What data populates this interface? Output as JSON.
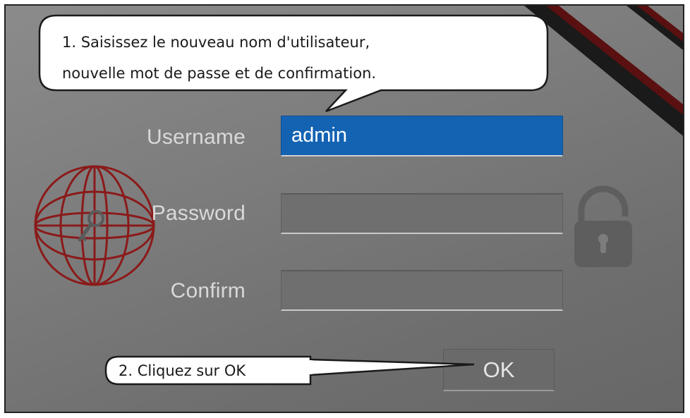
{
  "callout_1": {
    "line_1": "1. Saisissez le nouveau nom d'utilisateur,",
    "line_2": "nouvelle mot de passe et de confirmation."
  },
  "callout_2": {
    "text": "2. Cliquez sur OK"
  },
  "form": {
    "username_label": "Username",
    "username_value": "admin",
    "password_label": "Password",
    "password_value": "",
    "confirm_label": "Confirm",
    "confirm_value": "",
    "ok_label": "OK"
  },
  "icons": {
    "globe": "globe-key-icon",
    "lock": "padlock-icon"
  },
  "colors": {
    "active_field": "#1463b3",
    "globe_red": "#8b1a1a",
    "stripe_red": "#6b1010"
  }
}
